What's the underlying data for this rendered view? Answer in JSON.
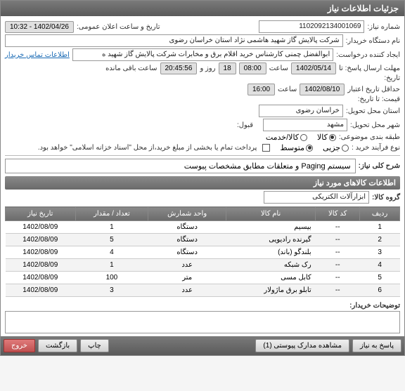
{
  "title": "جزئیات اطلاعات نیاز",
  "header": {
    "reqNoLabel": "شماره نیاز:",
    "reqNo": "1102092134001069",
    "announceLabel": "تاریخ و ساعت اعلان عمومی:",
    "announceDate": "1402/04/26 - 10:32",
    "buyerLabel": "نام دستگاه خریدار:",
    "buyer": "شرکت پالایش گاز شهید هاشمی نژاد   استان خراسان رضوی",
    "creatorLabel": "ایجاد کننده درخواست:",
    "creator": "ابوالفضل چمنی کارشناس خرید اقلام برق و مخابرات شرکت پالایش گاز شهید ه",
    "contactLink": "اطلاعات تماس خریدار",
    "deadlineLabel1": "مهلت ارسال پاسخ: تا",
    "deadlineLabel2": "تاریخ:",
    "deadlineDate": "1402/05/14",
    "hourLabel": "ساعت",
    "deadlineHour": "08:00",
    "daysRemain": "18",
    "daysLabel": "روز و",
    "countdown": "20:45:56",
    "remainLabel": "ساعت باقی مانده",
    "validLabel1": "حداقل تاریخ اعتبار",
    "validLabel2": "قیمت: تا تاریخ:",
    "validDate": "1402/08/10",
    "validHour": "16:00",
    "provinceLabel": "استان محل تحویل:",
    "province": "خراسان رضوی",
    "cityLabel": "شهر محل تحویل:",
    "city": "مشهد",
    "billLabel": "قبول:",
    "classifyLabel": "طبقه بندی موضوعی:",
    "classifyGoods": "کالا",
    "classifyService": "کالا/خدمت",
    "buyTypeLabel": "نوع فرآیند خرید :",
    "buyTypeSmall": "جزیی",
    "buyTypeMid": "متوسط",
    "payNote": "پرداخت تمام یا بخشی از مبلغ خرید،از محل \"اسناد خزانه اسلامی\" خواهد بود."
  },
  "descLabel": "شرح کلی نیاز:",
  "desc": "سیستم Paging و متعلقات مطابق مشخصات پیوست",
  "itemsHeader": "اطلاعات کالاهای مورد نیاز",
  "groupLabel": "گروه کالا:",
  "group": "ابزارآلات الکتریکی",
  "cols": {
    "row": "ردیف",
    "code": "کد کالا",
    "name": "نام کالا",
    "unit": "واحد شمارش",
    "qty": "تعداد / مقدار",
    "date": "تاریخ نیاز"
  },
  "items": [
    {
      "row": "1",
      "code": "--",
      "name": "بیسیم",
      "unit": "دستگاه",
      "qty": "1",
      "date": "1402/08/09"
    },
    {
      "row": "2",
      "code": "--",
      "name": "گیرنده رادیویی",
      "unit": "دستگاه",
      "qty": "5",
      "date": "1402/08/09"
    },
    {
      "row": "3",
      "code": "--",
      "name": "بلندگو (باند)",
      "unit": "دستگاه",
      "qty": "4",
      "date": "1402/08/09"
    },
    {
      "row": "4",
      "code": "--",
      "name": "رک شبکه",
      "unit": "عدد",
      "qty": "1",
      "date": "1402/08/09"
    },
    {
      "row": "5",
      "code": "--",
      "name": "کابل مسی",
      "unit": "متر",
      "qty": "100",
      "date": "1402/08/09"
    },
    {
      "row": "6",
      "code": "--",
      "name": "تابلو برق ماژولار",
      "unit": "عدد",
      "qty": "3",
      "date": "1402/08/09"
    }
  ],
  "notesLabel": "توضیحات خریدار:",
  "buttons": {
    "reply": "پاسخ به نیاز",
    "attach": "مشاهده مدارک پیوستی (1)",
    "print": "چاپ",
    "back": "بازگشت",
    "exit": "خروج"
  }
}
